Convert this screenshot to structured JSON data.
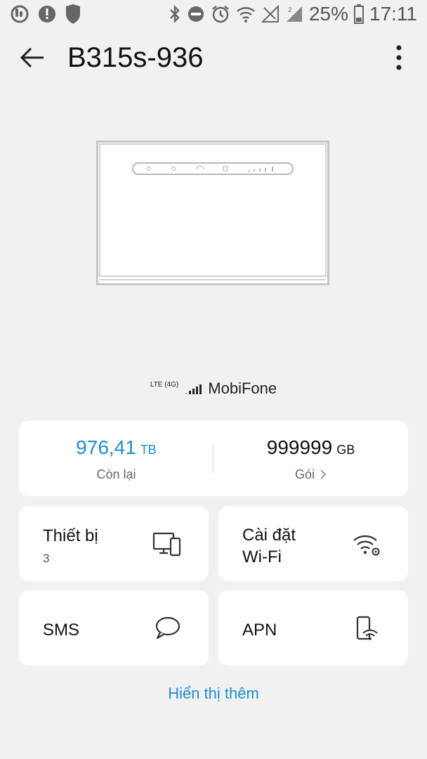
{
  "status_bar": {
    "battery": "25%",
    "time": "17:11",
    "icons": [
      "touch-assist-icon",
      "alert-icon",
      "shield-icon",
      "bluetooth-icon",
      "do-not-disturb-icon",
      "alarm-icon",
      "wifi-icon",
      "signal-icon",
      "signal-2-icon",
      "battery-icon"
    ]
  },
  "app_bar": {
    "title": "B315s-936"
  },
  "network": {
    "lte_label": "LTE (4G)",
    "carrier": "MobiFone"
  },
  "data_usage": {
    "remaining_value": "976,41",
    "remaining_unit": "TB",
    "remaining_label": "Còn lại",
    "package_value": "999999",
    "package_unit": "GB",
    "package_label": "Gói",
    "accent_color": "#1a8fd6"
  },
  "tiles": {
    "devices_title": "Thiết bị",
    "devices_count": "3",
    "wifi_settings_line1": "Cài đặt",
    "wifi_settings_line2": "Wi-Fi",
    "sms_title": "SMS",
    "apn_title": "APN"
  },
  "show_more": "Hiển thị thêm"
}
